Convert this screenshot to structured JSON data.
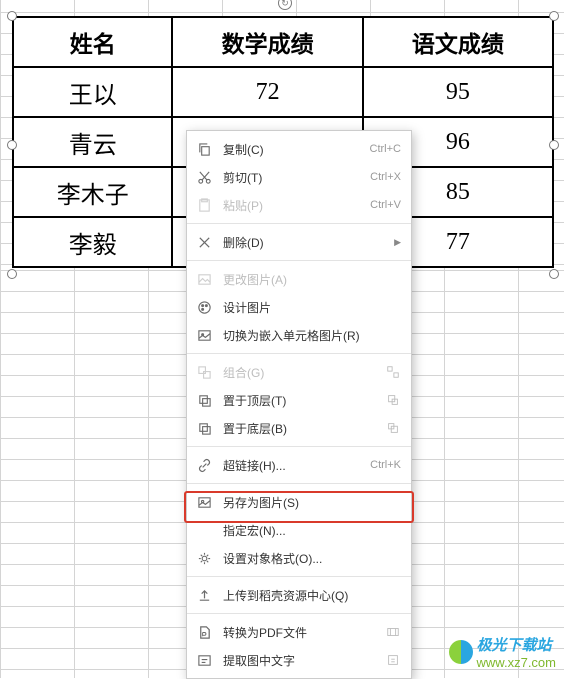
{
  "table": {
    "headers": [
      "姓名",
      "数学成绩",
      "语文成绩"
    ],
    "rows": [
      {
        "name": "王以",
        "math": "72",
        "chinese": "95"
      },
      {
        "name": "青云",
        "math": "",
        "chinese": "96"
      },
      {
        "name": "李木子",
        "math": "",
        "chinese": "85"
      },
      {
        "name": "李毅",
        "math": "",
        "chinese": "77"
      }
    ]
  },
  "context_menu": {
    "copy": {
      "label": "复制(C)",
      "shortcut": "Ctrl+C"
    },
    "cut": {
      "label": "剪切(T)",
      "shortcut": "Ctrl+X"
    },
    "paste": {
      "label": "粘贴(P)",
      "shortcut": "Ctrl+V"
    },
    "delete": {
      "label": "删除(D)"
    },
    "change_pic": {
      "label": "更改图片(A)"
    },
    "design_pic": {
      "label": "设计图片"
    },
    "embed": {
      "label": "切换为嵌入单元格图片(R)"
    },
    "group": {
      "label": "组合(G)"
    },
    "bring_front": {
      "label": "置于顶层(T)"
    },
    "send_back": {
      "label": "置于底层(B)"
    },
    "hyperlink": {
      "label": "超链接(H)...",
      "shortcut": "Ctrl+K"
    },
    "save_as_pic": {
      "label": "另存为图片(S)"
    },
    "assign_macro": {
      "label": "指定宏(N)..."
    },
    "format_obj": {
      "label": "设置对象格式(O)..."
    },
    "upload": {
      "label": "上传到稻壳资源中心(Q)"
    },
    "to_pdf": {
      "label": "转换为PDF文件"
    },
    "extract_text": {
      "label": "提取图中文字"
    }
  },
  "watermark": {
    "brand": "极光下载站",
    "url": "www.xz7.com"
  },
  "chart_data": {
    "type": "table",
    "title": "",
    "columns": [
      "姓名",
      "数学成绩",
      "语文成绩"
    ],
    "rows": [
      [
        "王以",
        72,
        95
      ],
      [
        "青云",
        null,
        96
      ],
      [
        "李木子",
        null,
        85
      ],
      [
        "李毅",
        null,
        77
      ]
    ]
  }
}
